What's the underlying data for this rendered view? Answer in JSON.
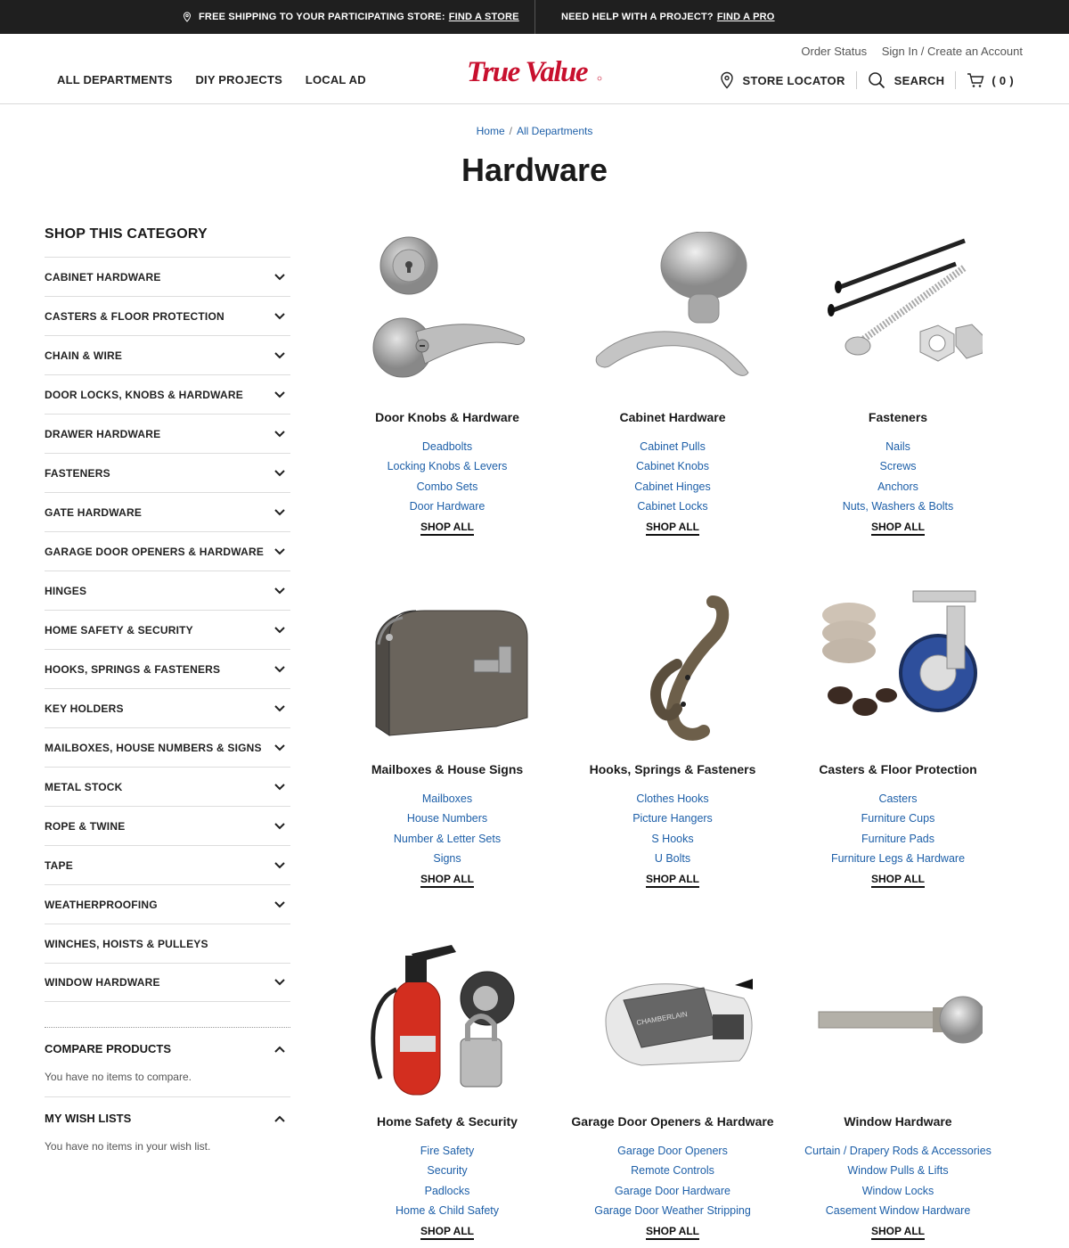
{
  "promo": {
    "shipping_text": "FREE SHIPPING TO YOUR PARTICIPATING STORE:",
    "shipping_link": "FIND A STORE",
    "help_text": "NEED HELP WITH A PROJECT?",
    "help_link": "FIND A PRO"
  },
  "header": {
    "order_status": "Order Status",
    "sign_in": "Sign In / Create an Account",
    "nav": [
      "ALL DEPARTMENTS",
      "DIY PROJECTS",
      "LOCAL AD"
    ],
    "logo_text": "True Value",
    "store_locator": "STORE LOCATOR",
    "search": "SEARCH",
    "cart_count": "( 0 )"
  },
  "breadcrumb": {
    "home": "Home",
    "current": "All Departments"
  },
  "page_title": "Hardware",
  "sidebar": {
    "heading": "SHOP THIS CATEGORY",
    "categories": [
      "CABINET HARDWARE",
      "CASTERS & FLOOR PROTECTION",
      "CHAIN & WIRE",
      "DOOR LOCKS, KNOBS & HARDWARE",
      "DRAWER HARDWARE",
      "FASTENERS",
      "GATE HARDWARE",
      "GARAGE DOOR OPENERS & HARDWARE",
      "HINGES",
      "HOME SAFETY & SECURITY",
      "HOOKS, SPRINGS & FASTENERS",
      "KEY HOLDERS",
      "MAILBOXES, HOUSE NUMBERS & SIGNS",
      "METAL STOCK",
      "ROPE & TWINE",
      "TAPE",
      "WEATHERPROOFING",
      "WINCHES, HOISTS & PULLEYS",
      "WINDOW HARDWARE"
    ],
    "compare_heading": "COMPARE PRODUCTS",
    "compare_text": "You have no items to compare.",
    "wishlist_heading": "MY WISH LISTS",
    "wishlist_text": "You have no items in your wish list."
  },
  "cards": [
    {
      "title": "Door Knobs & Hardware",
      "links": [
        "Deadbolts",
        "Locking Knobs & Levers",
        "Combo Sets",
        "Door Hardware"
      ],
      "shop": "SHOP ALL",
      "icon": "door-knob-image"
    },
    {
      "title": "Cabinet Hardware",
      "links": [
        "Cabinet Pulls",
        "Cabinet Knobs",
        "Cabinet Hinges",
        "Cabinet Locks"
      ],
      "shop": "SHOP ALL",
      "icon": "cabinet-knob-image"
    },
    {
      "title": "Fasteners",
      "links": [
        "Nails",
        "Screws",
        "Anchors",
        "Nuts, Washers & Bolts"
      ],
      "shop": "SHOP ALL",
      "icon": "fasteners-image"
    },
    {
      "title": "Mailboxes & House Signs",
      "links": [
        "Mailboxes",
        "House Numbers",
        "Number & Letter Sets",
        "Signs"
      ],
      "shop": "SHOP ALL",
      "icon": "mailbox-image"
    },
    {
      "title": "Hooks, Springs & Fasteners",
      "links": [
        "Clothes Hooks",
        "Picture Hangers",
        "S Hooks",
        "U Bolts"
      ],
      "shop": "SHOP ALL",
      "icon": "hook-image"
    },
    {
      "title": "Casters & Floor Protection",
      "links": [
        "Casters",
        "Furniture Cups",
        "Furniture Pads",
        "Furniture Legs & Hardware"
      ],
      "shop": "SHOP ALL",
      "icon": "caster-image"
    },
    {
      "title": "Home Safety & Security",
      "links": [
        "Fire Safety",
        "Security",
        "Padlocks",
        "Home & Child Safety"
      ],
      "shop": "SHOP ALL",
      "icon": "fire-extinguisher-image"
    },
    {
      "title": "Garage Door Openers & Hardware",
      "links": [
        "Garage Door Openers",
        "Remote Controls",
        "Garage Door Hardware",
        "Garage Door Weather Stripping"
      ],
      "shop": "SHOP ALL",
      "icon": "garage-opener-image"
    },
    {
      "title": "Window Hardware",
      "links": [
        "Curtain / Drapery Rods & Accessories",
        "Window Pulls & Lifts",
        "Window Locks",
        "Casement Window Hardware"
      ],
      "shop": "SHOP ALL",
      "icon": "curtain-rod-image"
    }
  ],
  "colors": {
    "promo_bg": "#1f1f1f",
    "brand_red": "#c8102e",
    "link_blue": "#1d5fa8"
  }
}
